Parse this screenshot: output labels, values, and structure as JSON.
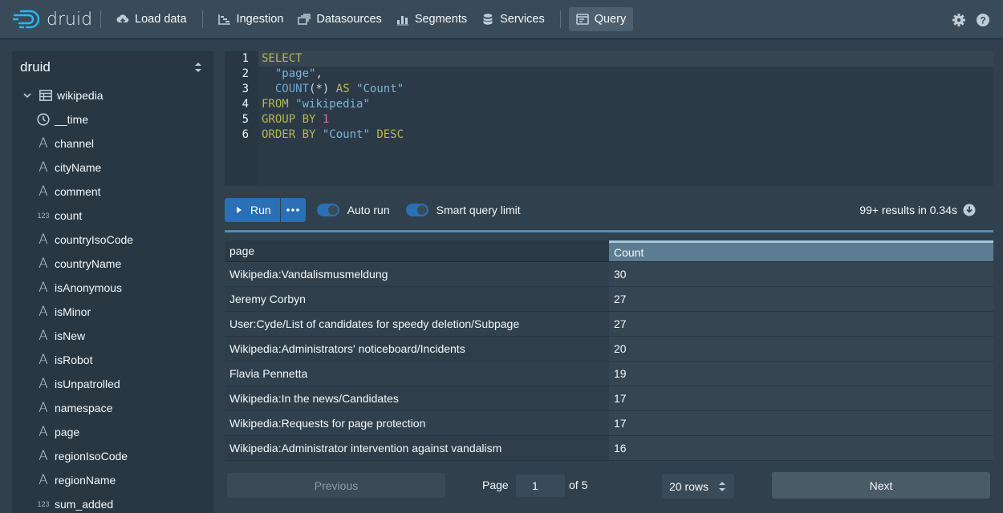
{
  "app": {
    "logo_text": "druid"
  },
  "nav": {
    "items": [
      {
        "label": "Load data",
        "icon": "cloud-upload-icon"
      },
      {
        "label": "Ingestion",
        "icon": "gantt-chart-icon"
      },
      {
        "label": "Datasources",
        "icon": "multi-select-icon"
      },
      {
        "label": "Segments",
        "icon": "stacked-chart-icon"
      },
      {
        "label": "Services",
        "icon": "database-icon"
      },
      {
        "label": "Query",
        "icon": "application-icon",
        "active": true
      }
    ]
  },
  "sidebar": {
    "database": "druid",
    "table": "wikipedia",
    "columns": [
      {
        "name": "__time",
        "type": "time"
      },
      {
        "name": "channel",
        "type": "string"
      },
      {
        "name": "cityName",
        "type": "string"
      },
      {
        "name": "comment",
        "type": "string"
      },
      {
        "name": "count",
        "type": "number"
      },
      {
        "name": "countryIsoCode",
        "type": "string"
      },
      {
        "name": "countryName",
        "type": "string"
      },
      {
        "name": "isAnonymous",
        "type": "string"
      },
      {
        "name": "isMinor",
        "type": "string"
      },
      {
        "name": "isNew",
        "type": "string"
      },
      {
        "name": "isRobot",
        "type": "string"
      },
      {
        "name": "isUnpatrolled",
        "type": "string"
      },
      {
        "name": "namespace",
        "type": "string"
      },
      {
        "name": "page",
        "type": "string"
      },
      {
        "name": "regionIsoCode",
        "type": "string"
      },
      {
        "name": "regionName",
        "type": "string"
      },
      {
        "name": "sum_added",
        "type": "number"
      }
    ]
  },
  "editor": {
    "line_numbers": [
      "1",
      "2",
      "3",
      "4",
      "5",
      "6"
    ],
    "lines": [
      "SELECT",
      "  \"page\",",
      "  COUNT(*) AS \"Count\"",
      "FROM \"wikipedia\"",
      "GROUP BY 1",
      "ORDER BY \"Count\" DESC"
    ]
  },
  "runbar": {
    "run_label": "Run",
    "auto_run_label": "Auto run",
    "smart_limit_label": "Smart query limit",
    "auto_run_on": true,
    "smart_limit_on": true,
    "results_info": "99+ results in 0.34s"
  },
  "results": {
    "columns": [
      "page",
      "Count"
    ],
    "rows": [
      [
        "Wikipedia:Vandalismusmeldung",
        "30"
      ],
      [
        "Jeremy Corbyn",
        "27"
      ],
      [
        "User:Cyde/List of candidates for speedy deletion/Subpage",
        "27"
      ],
      [
        "Wikipedia:Administrators' noticeboard/Incidents",
        "20"
      ],
      [
        "Flavia Pennetta",
        "19"
      ],
      [
        "Wikipedia:In the news/Candidates",
        "17"
      ],
      [
        "Wikipedia:Requests for page protection",
        "17"
      ],
      [
        "Wikipedia:Administrator intervention against vandalism",
        "16"
      ]
    ]
  },
  "pager": {
    "previous_label": "Previous",
    "page_label": "Page",
    "page_value": "1",
    "of_label": "of 5",
    "rows_label": "20 rows",
    "next_label": "Next"
  },
  "colors": {
    "accent": "#2b6fb5",
    "background": "#30404d",
    "navbar": "#394b59"
  }
}
